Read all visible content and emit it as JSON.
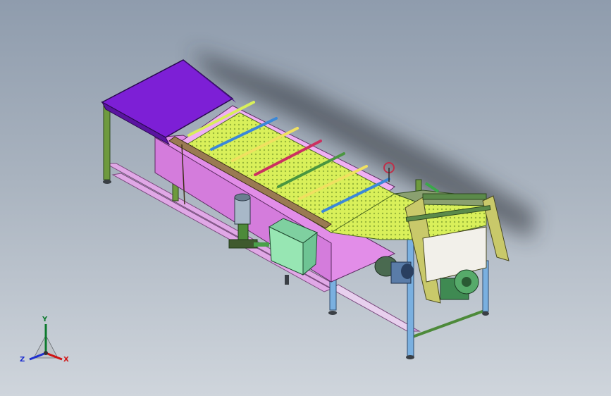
{
  "viewport": {
    "background_top": "#8f9cad",
    "background_bottom": "#cfd5dc"
  },
  "model": {
    "colors": {
      "hopper_top": "#7d1fd6",
      "tank": "#e28de8",
      "tank_dark": "#c96fd2",
      "frame_green": "#4d8a3a",
      "mesh": "#d9f05a",
      "mesh_dark": "#97b53a",
      "rail_brown": "#9a7a52",
      "motor_blue": "#5a7ca8",
      "side_panel": "#c9c96a",
      "box": "#97e6b3",
      "legs": "#7ab0e0",
      "base_rails": "#e0a8e6"
    },
    "bar_colors": [
      "#d8ef5a",
      "#3b88d8",
      "#f0e060",
      "#cc3060",
      "#4a9640",
      "#f0e060",
      "#3b88d8"
    ]
  },
  "triad": {
    "x_label": "X",
    "y_label": "Y",
    "z_label": "Z",
    "x_color": "#d01414",
    "y_color": "#0c7a2d",
    "z_color": "#1e2fcf"
  }
}
